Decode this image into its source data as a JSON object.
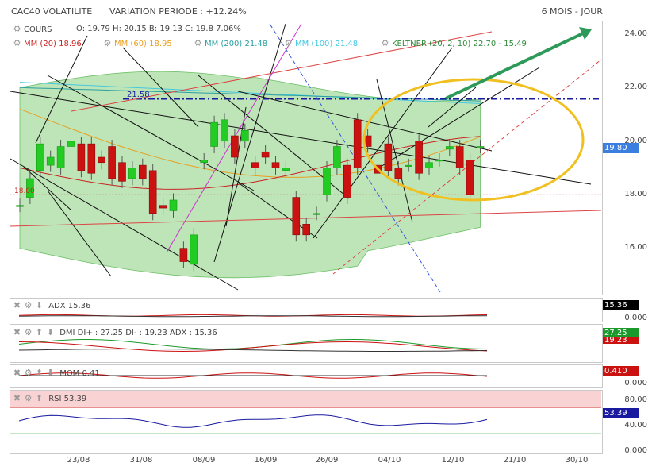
{
  "header": {
    "title": "CAC40 VOLATILITE",
    "variation": "VARIATION PERIODE : +12.24%",
    "period": "6 MOIS - JOUR"
  },
  "legend": {
    "cours": "COURS",
    "ohlc": "O: 19.79    H: 20.15    B: 19.13    C: 19.8 7.06%",
    "mm20": "MM (20)  18.96",
    "mm60": "MM (60)  18.95",
    "mm200": "MM (200)  21.48",
    "mm100": "MM (100)  21.48",
    "keltner": "KELTNER  (20, 2, 10)  22.70 - 15.49",
    "level_blue": "21.58",
    "level_red": "18.00"
  },
  "colors": {
    "up": "#22cc22",
    "down": "#cc1111",
    "band": "#a8dca0",
    "mm20": "#cc2222",
    "mm60": "#e8a020",
    "mm200": "#2aa0a0",
    "mm100": "#44c8e0",
    "ellipse": "#f0c020",
    "arrow": "#2e9a5a",
    "blue_line": "#1a1aa0"
  },
  "chart_data": [
    {
      "type": "candlestick",
      "title": "CAC40 VOLATILITE",
      "ylim": [
        14.3,
        24.5
      ],
      "y_ticks": [
        "24.00",
        "22.00",
        "20.00",
        "18.00",
        "16.00"
      ],
      "last_value": "19.80",
      "x_ticks": [
        "23/08",
        "31/08",
        "08/09",
        "16/09",
        "26/09",
        "04/10",
        "12/10",
        "21/10",
        "30/10"
      ],
      "candles": [
        [
          17.6,
          17.6
        ],
        [
          17.9,
          18.6
        ],
        [
          18.9,
          19.9
        ],
        [
          19.1,
          19.4
        ],
        [
          19.0,
          19.8
        ],
        [
          19.8,
          20.0
        ],
        [
          19.9,
          18.9
        ],
        [
          19.9,
          18.8
        ],
        [
          19.4,
          19.2
        ],
        [
          19.8,
          18.6
        ],
        [
          19.2,
          18.5
        ],
        [
          18.6,
          19.0
        ],
        [
          19.1,
          18.6
        ],
        [
          18.9,
          17.3
        ],
        [
          17.6,
          17.5
        ],
        [
          17.4,
          17.8
        ],
        [
          16.0,
          15.5
        ],
        [
          15.4,
          16.5
        ],
        [
          19.2,
          19.3
        ],
        [
          19.8,
          20.7
        ],
        [
          20.0,
          20.8
        ],
        [
          20.2,
          19.4
        ],
        [
          20.0,
          20.4
        ],
        [
          19.2,
          19.0
        ],
        [
          19.6,
          19.4
        ],
        [
          19.2,
          19.0
        ],
        [
          18.9,
          19.0
        ],
        [
          17.9,
          16.5
        ],
        [
          16.9,
          16.5
        ],
        [
          17.3,
          17.3
        ],
        [
          18.0,
          19.0
        ],
        [
          19.0,
          19.8
        ],
        [
          19.1,
          17.9
        ],
        [
          20.8,
          19.0
        ],
        [
          20.2,
          19.8
        ],
        [
          19.1,
          18.8
        ],
        [
          19.9,
          18.9
        ],
        [
          19.0,
          18.6
        ],
        [
          19.1,
          19.1
        ],
        [
          20.0,
          18.8
        ],
        [
          19.0,
          19.2
        ],
        [
          19.3,
          19.3
        ],
        [
          19.7,
          19.8
        ],
        [
          19.8,
          19.0
        ],
        [
          19.3,
          18.0
        ],
        [
          19.8,
          19.8
        ]
      ]
    },
    {
      "type": "line",
      "title": "ADX",
      "value": "15.36",
      "ticks": [
        "0.000"
      ]
    },
    {
      "type": "line",
      "title": "DMI",
      "values": "DI+ : 27.25  DI- : 19.23  ADX : 15.36",
      "badges": [
        "27.25",
        "19.23"
      ]
    },
    {
      "type": "line",
      "title": "MOM",
      "value": "0.41",
      "badge": "0.410",
      "ticks": [
        "0.000"
      ]
    },
    {
      "type": "line",
      "title": "RSI",
      "value": "53.39",
      "ticks": [
        "80.00",
        "40.00",
        "0.000"
      ]
    }
  ]
}
